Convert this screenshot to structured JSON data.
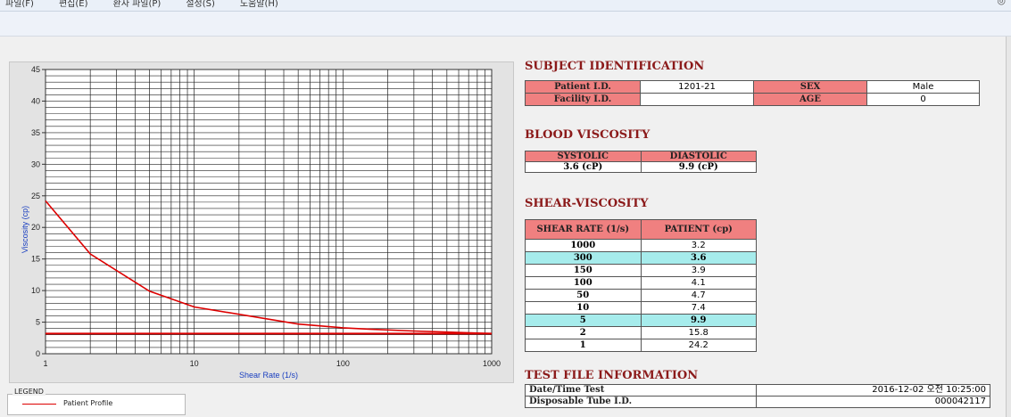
{
  "menu": {
    "items": [
      "파일(F)",
      "편집(E)",
      "환자 파일(P)",
      "설정(S)",
      "도움말(H)"
    ]
  },
  "subject": {
    "title": "SUBJECT IDENTIFICATION",
    "patient_id_label": "Patient I.D.",
    "patient_id": "1201-21",
    "sex_label": "SEX",
    "sex": "Male",
    "facility_id_label": "Facility I.D.",
    "facility_id": "",
    "age_label": "AGE",
    "age": "0"
  },
  "blood_viscosity": {
    "title": "BLOOD VISCOSITY",
    "systolic_label": "SYSTOLIC",
    "diastolic_label": "DIASTOLIC",
    "systolic": "3.6 (cP)",
    "diastolic": "9.9 (cP)"
  },
  "shear": {
    "title": "SHEAR-VISCOSITY",
    "col1": "SHEAR RATE (1/s)",
    "col2": "PATIENT (cp)",
    "rows": [
      {
        "rate": "1000",
        "value": "3.2",
        "highlight": false
      },
      {
        "rate": "300",
        "value": "3.6",
        "highlight": true
      },
      {
        "rate": "150",
        "value": "3.9",
        "highlight": false
      },
      {
        "rate": "100",
        "value": "4.1",
        "highlight": false
      },
      {
        "rate": "50",
        "value": "4.7",
        "highlight": false
      },
      {
        "rate": "10",
        "value": "7.4",
        "highlight": false
      },
      {
        "rate": "5",
        "value": "9.9",
        "highlight": true
      },
      {
        "rate": "2",
        "value": "15.8",
        "highlight": false
      },
      {
        "rate": "1",
        "value": "24.2",
        "highlight": false
      }
    ]
  },
  "test_file": {
    "title": "TEST FILE INFORMATION",
    "datetime_label": "Date/Time Test",
    "datetime": "2016-12-02  오전 10:25:00",
    "tube_label": "Disposable Tube I.D.",
    "tube": "000042117"
  },
  "legend": {
    "title": "LEGEND",
    "series_name": "Patient Profile"
  },
  "colors": {
    "curve": "#dd0000",
    "header_fill": "#f08080",
    "highlight_row": "#a6ecec",
    "section_title": "#8b1a1a"
  },
  "chart_data": {
    "type": "line",
    "title": "",
    "xlabel": "Shear Rate (1/s)",
    "ylabel": "Viscosity (cp)",
    "x_scale": "log",
    "xlim": [
      1,
      1000
    ],
    "ylim": [
      0,
      45
    ],
    "x_tick_labels": [
      "1",
      "10",
      "100",
      "1000"
    ],
    "y_tick_labels": [
      "0",
      "5",
      "10",
      "15",
      "20",
      "25",
      "30",
      "35",
      "40",
      "45"
    ],
    "grid": true,
    "legend_position": "below-left",
    "series": [
      {
        "name": "Patient Profile",
        "x": [
          1,
          2,
          5,
          10,
          50,
          100,
          150,
          300,
          1000
        ],
        "y": [
          24.2,
          15.8,
          9.9,
          7.4,
          4.7,
          4.1,
          3.9,
          3.6,
          3.2
        ]
      }
    ],
    "baseline_y": 3.2
  }
}
